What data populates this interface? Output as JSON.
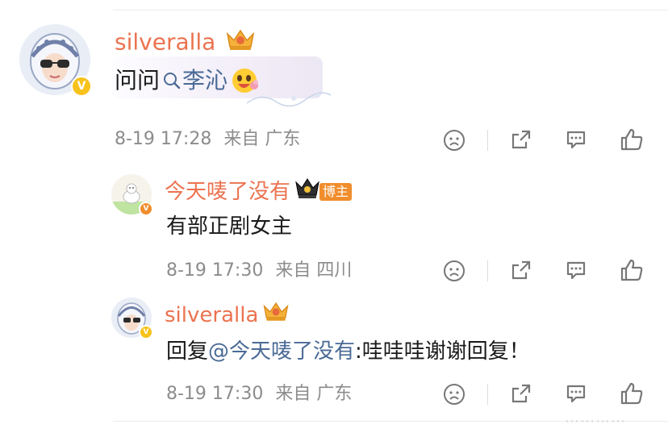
{
  "comments": [
    {
      "username": "silveralla",
      "content_prefix": "问问",
      "content_link": "李沁",
      "timestamp": "8-19 17:28",
      "location": "来自 广东"
    },
    {
      "username": "今天唛了没有",
      "badge": "博主",
      "content": "有部正剧女主",
      "timestamp": "8-19 17:30",
      "location": "来自 四川"
    },
    {
      "username": "silveralla",
      "reply_prefix": "回复",
      "reply_mention": "@今天唛了没有",
      "reply_text": ":哇哇哇谢谢回复！",
      "timestamp": "8-19 17:30",
      "location": "来自 广东"
    }
  ],
  "icons": {
    "vip": "crown-icon",
    "verified": "verified-v-icon",
    "dislike": "sad-face-icon",
    "share": "share-icon",
    "comment": "comment-icon",
    "like": "thumbs-up-icon",
    "search": "search-icon",
    "emoji": "emoji-icon"
  },
  "colors": {
    "username": "#eb7350",
    "link": "#4a6a96",
    "meta": "#8c8c8c",
    "badge": "#f7c21b"
  }
}
